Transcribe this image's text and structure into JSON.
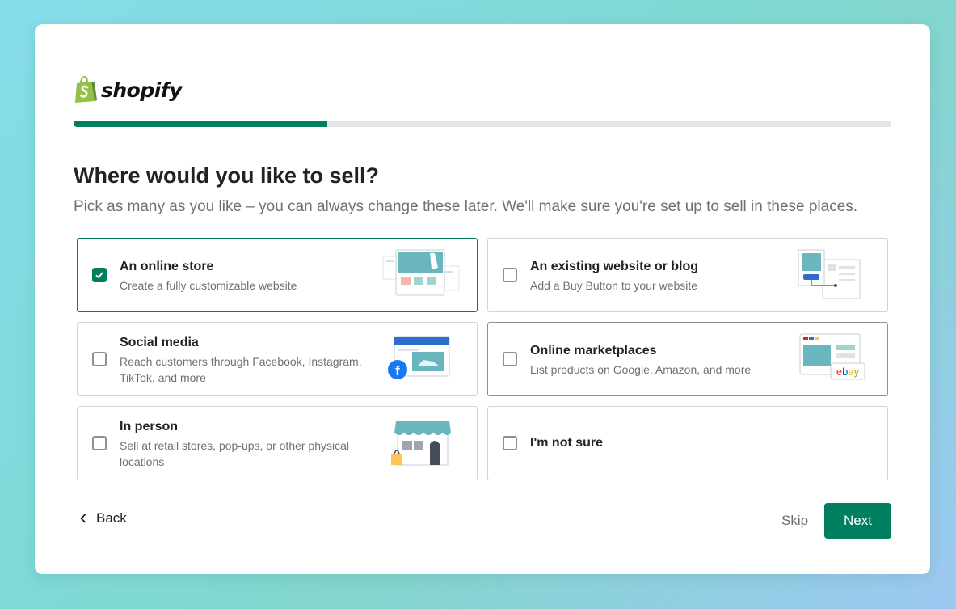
{
  "brand": {
    "name": "shopify"
  },
  "progress": {
    "fraction": 0.31
  },
  "page": {
    "title": "Where would you like to sell?",
    "subtitle": "Pick as many as you like – you can always change these later. We'll make sure you're set up to sell in these places."
  },
  "options": [
    {
      "title": "An online store",
      "description": "Create a fully customizable website",
      "checked": true,
      "icon": "online-store-illustration"
    },
    {
      "title": "An existing website or blog",
      "description": "Add a Buy Button to your website",
      "checked": false,
      "icon": "buy-button-illustration"
    },
    {
      "title": "Social media",
      "description": "Reach customers through Facebook, Instagram, TikTok, and more",
      "checked": false,
      "icon": "social-media-illustration"
    },
    {
      "title": "Online marketplaces",
      "description": "List products on Google, Amazon, and more",
      "checked": false,
      "icon": "marketplaces-illustration"
    },
    {
      "title": "In person",
      "description": "Sell at retail stores, pop-ups, or other physical locations",
      "checked": false,
      "icon": "storefront-illustration"
    },
    {
      "title": "I'm not sure",
      "description": "",
      "checked": false,
      "icon": ""
    }
  ],
  "footer": {
    "back_label": "Back",
    "skip_label": "Skip",
    "next_label": "Next"
  },
  "colors": {
    "accent": "#008060",
    "progress_track": "#e4e4e4",
    "text": "#202223",
    "muted": "#6d7175",
    "border": "#d2d5d8"
  }
}
